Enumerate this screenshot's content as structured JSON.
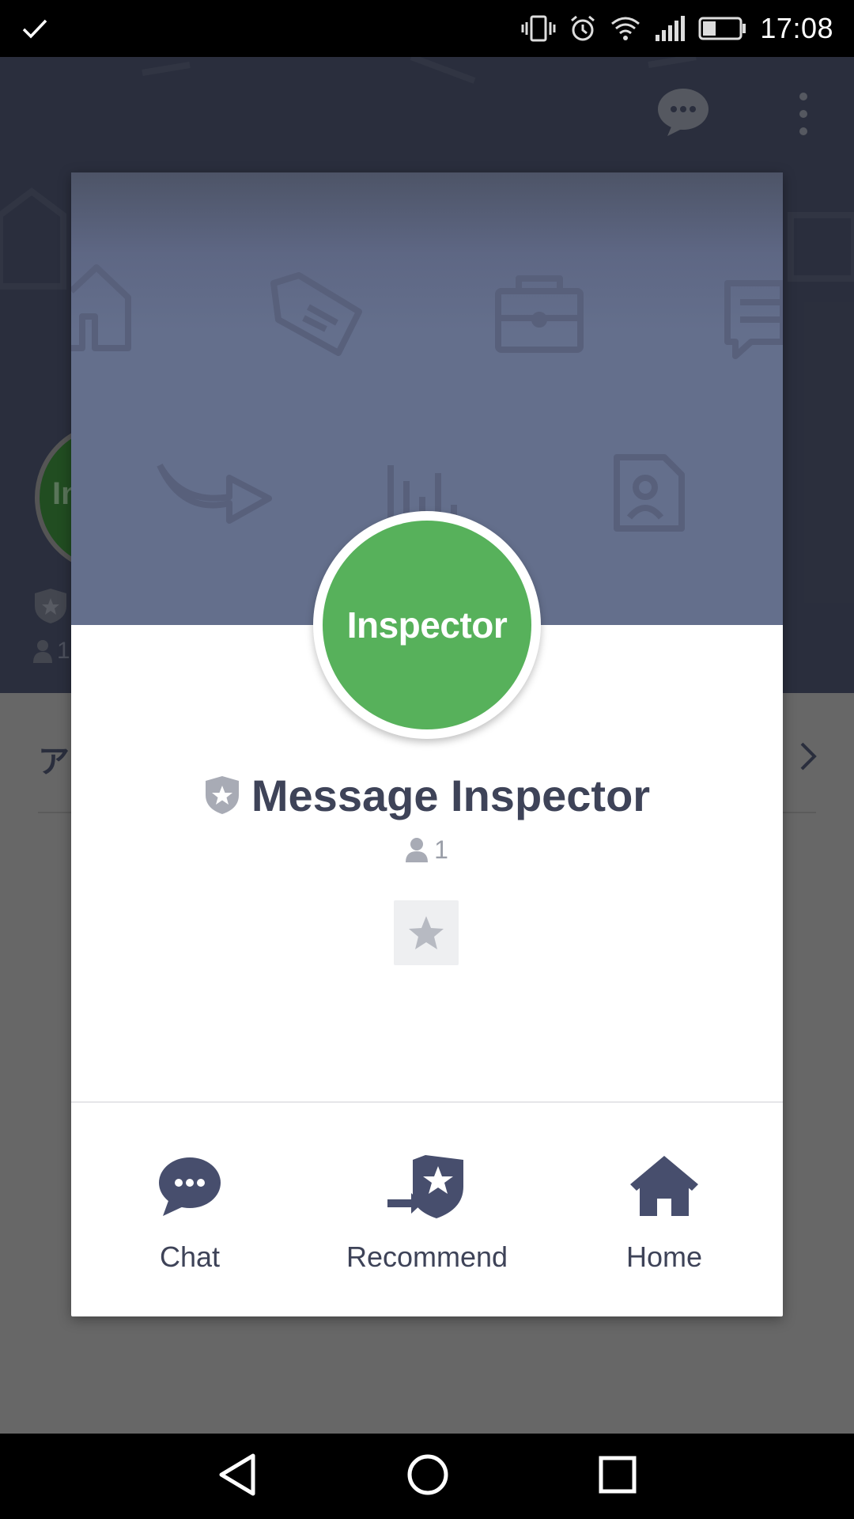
{
  "status_bar": {
    "time": "17:08",
    "icons": [
      "check-icon",
      "vibrate-icon",
      "alarm-icon",
      "wifi-icon",
      "signal-icon",
      "battery-icon"
    ]
  },
  "background": {
    "avatar_partial_text": "In",
    "friends_count": "1",
    "row_partial_text": "ア"
  },
  "dialog": {
    "avatar_text": "Inspector",
    "title": "Message Inspector",
    "friends_count": "1",
    "actions": [
      {
        "label": "Chat",
        "icon": "chat-bubble-icon"
      },
      {
        "label": "Recommend",
        "icon": "recommend-icon"
      },
      {
        "label": "Home",
        "icon": "home-icon"
      }
    ]
  },
  "colors": {
    "avatar_green": "#57b15b",
    "title_text": "#3e4358",
    "icon_navy": "#474e6d",
    "cover": "#646f8c"
  },
  "nav_bar": {
    "buttons": [
      "back-icon",
      "home-circle-icon",
      "recents-icon"
    ]
  }
}
